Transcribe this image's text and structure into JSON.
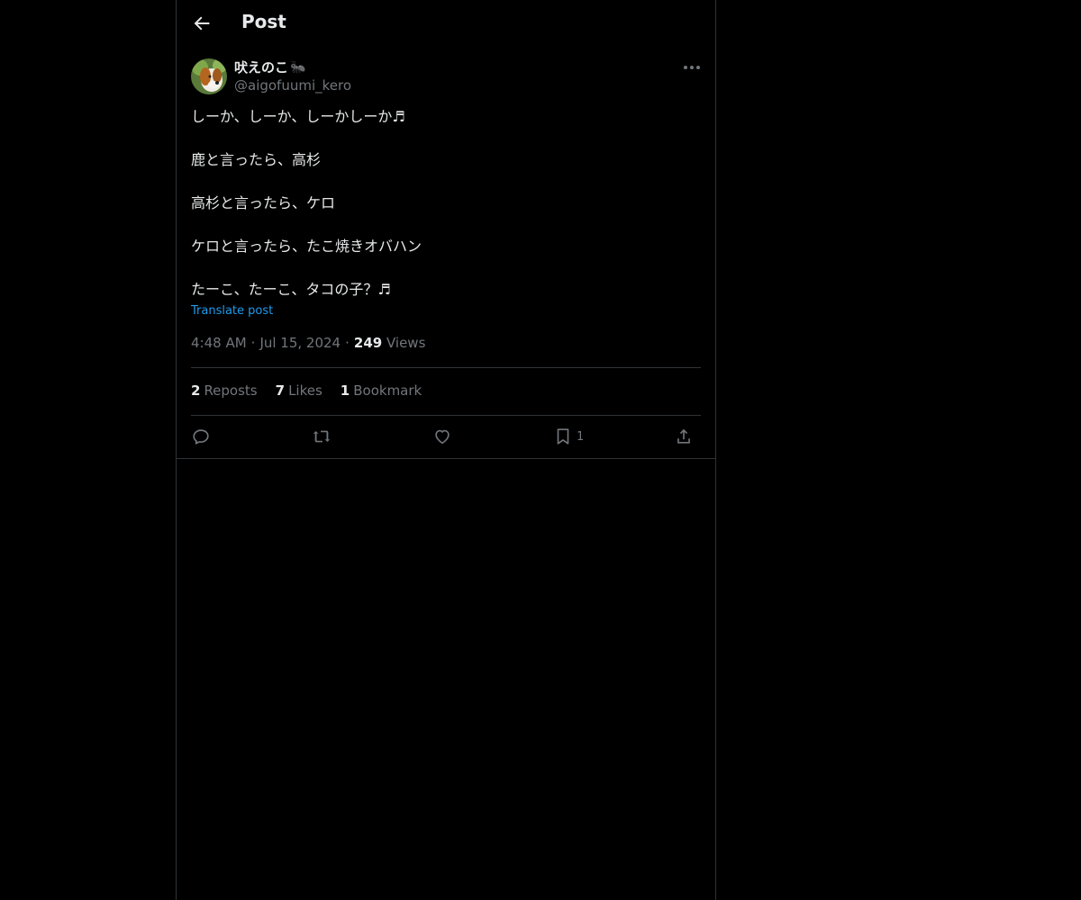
{
  "header": {
    "title": "Post"
  },
  "author": {
    "name": "吠えのこ",
    "handle": "@aigofuumi_kero",
    "name_emoji": "🐜"
  },
  "post": {
    "lines": [
      "しーか、しーか、しーかしーか♬",
      "鹿と言ったら、高杉",
      "高杉と言ったら、ケロ",
      "ケロと言ったら、たこ焼きオバハン",
      "たーこ、たーこ、タコの子？♬"
    ],
    "translate_label": "Translate post",
    "time": "4:48 AM",
    "date": "Jul 15, 2024",
    "views_count": "249",
    "views_label": "Views"
  },
  "stats": {
    "reposts_count": "2",
    "reposts_label": "Reposts",
    "likes_count": "7",
    "likes_label": "Likes",
    "bookmarks_count": "1",
    "bookmarks_label": "Bookmark"
  },
  "actions": {
    "bookmark_count": "1"
  },
  "icons": [
    "back-arrow-icon",
    "more-icon",
    "reply-icon",
    "repost-icon",
    "like-icon",
    "bookmark-icon",
    "share-icon"
  ],
  "colors": {
    "background": "#000000",
    "text": "#e7e9ea",
    "muted": "#71767b",
    "accent": "#1d9bf0",
    "border": "#2f3336"
  }
}
